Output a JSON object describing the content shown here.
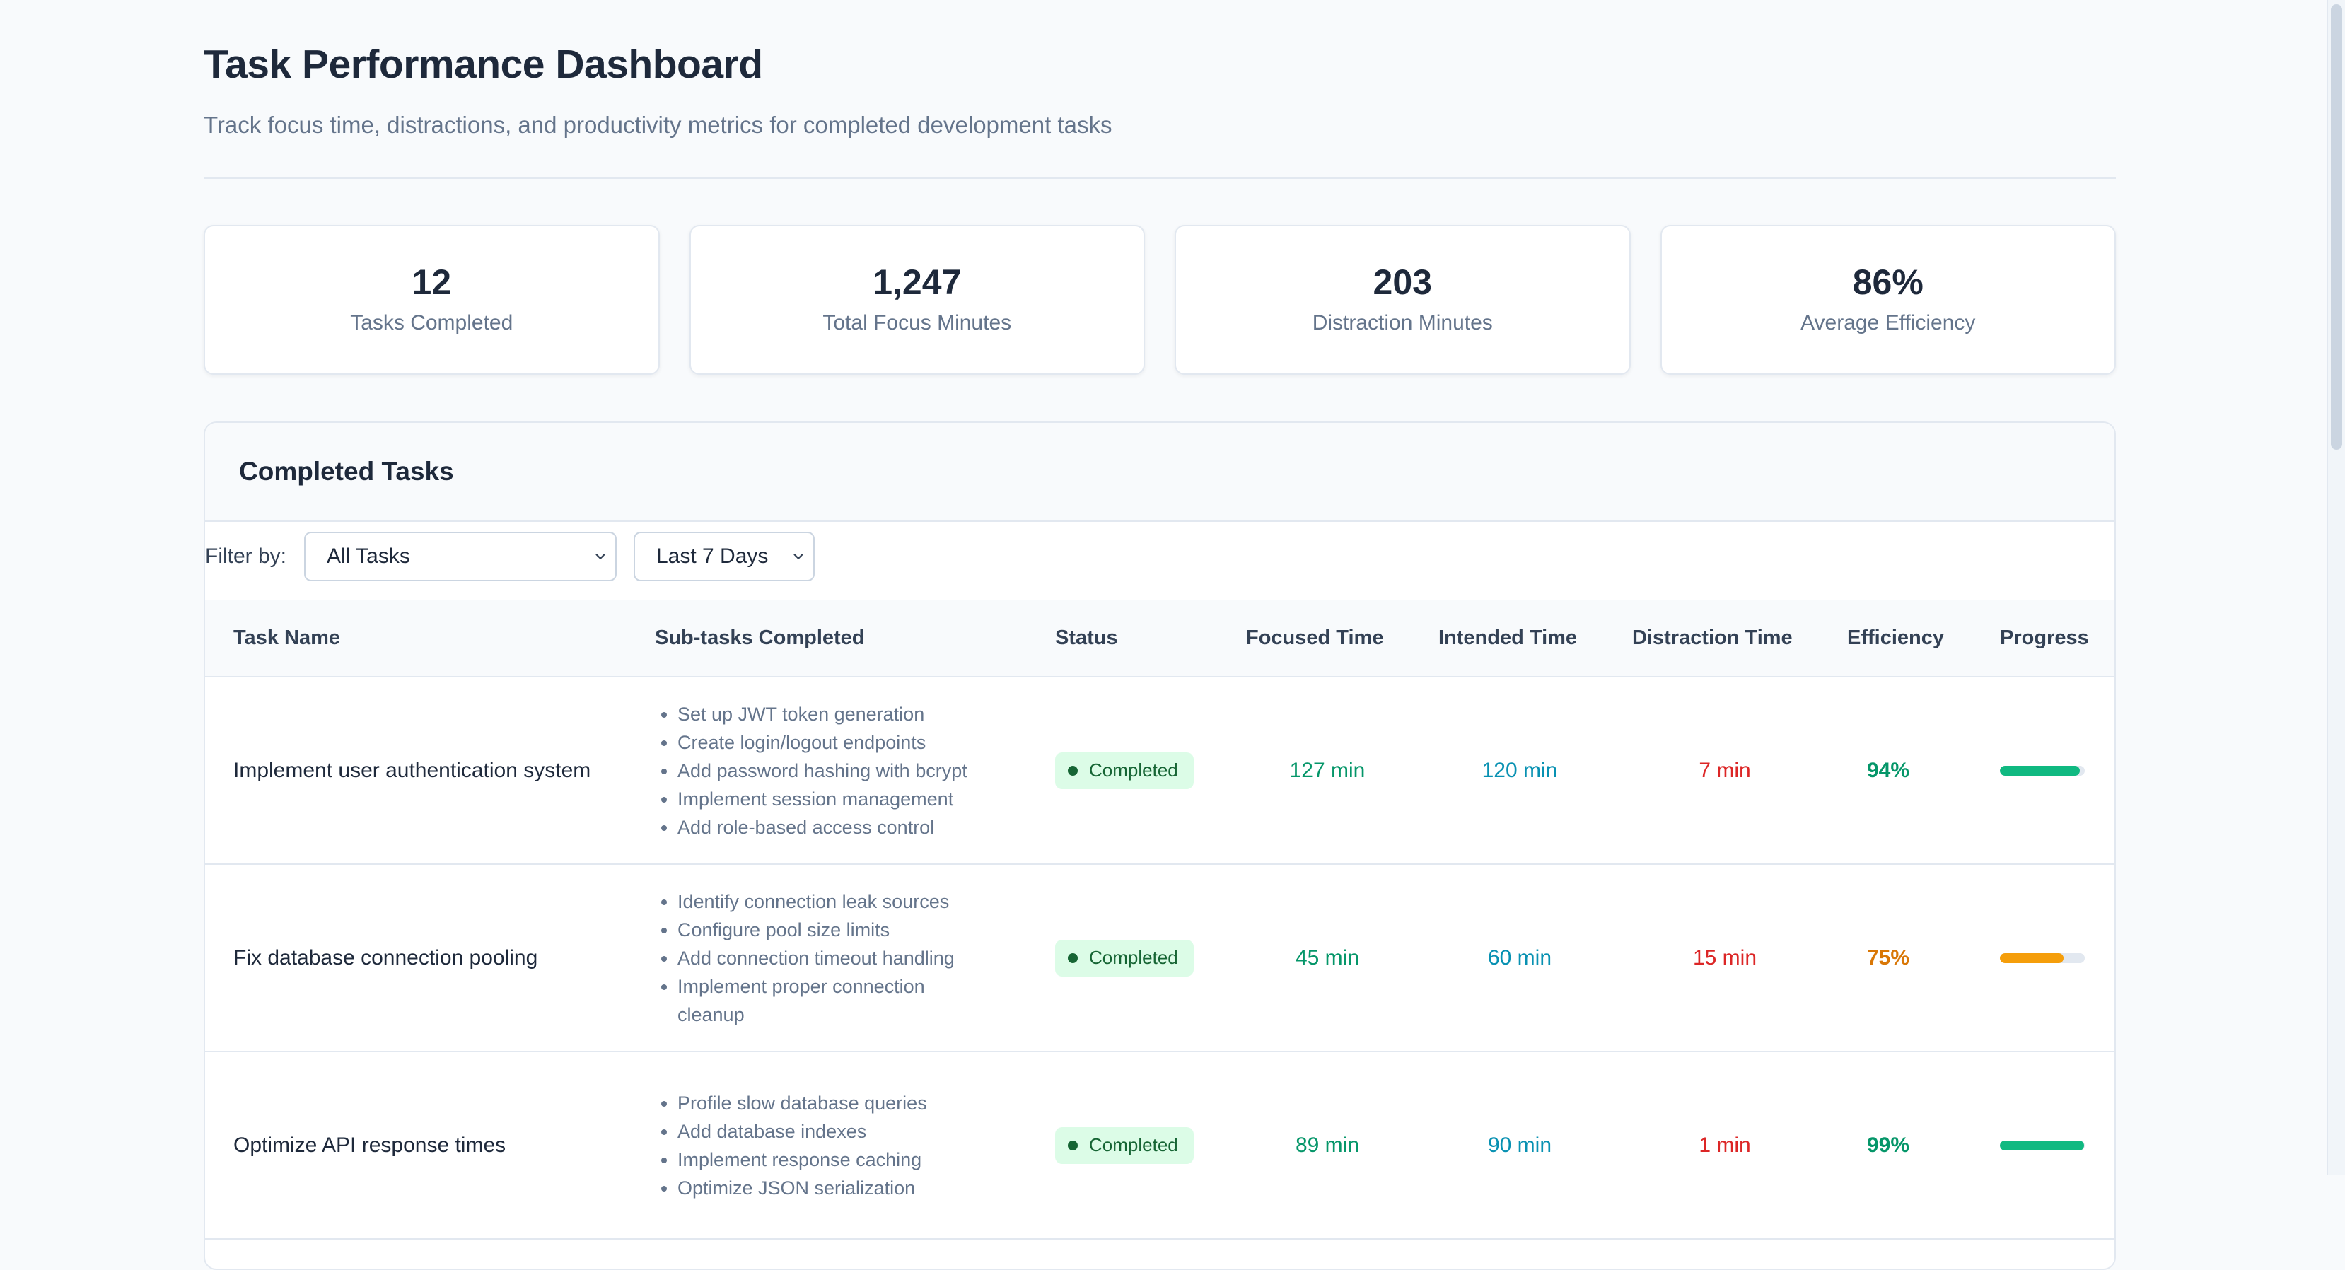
{
  "header": {
    "title": "Task Performance Dashboard",
    "subtitle": "Track focus time, distractions, and productivity metrics for completed development tasks"
  },
  "stats": [
    {
      "value": "12",
      "label": "Tasks Completed"
    },
    {
      "value": "1,247",
      "label": "Total Focus Minutes"
    },
    {
      "value": "203",
      "label": "Distraction Minutes"
    },
    {
      "value": "86%",
      "label": "Average Efficiency"
    }
  ],
  "panel": {
    "title": "Completed Tasks",
    "filter_label": "Filter by:",
    "task_filter": "All Tasks",
    "range_filter": "Last 7 Days"
  },
  "columns": {
    "task_name": "Task Name",
    "subtasks": "Sub-tasks Completed",
    "status": "Status",
    "focused": "Focused Time",
    "intended": "Intended Time",
    "distraction": "Distraction Time",
    "efficiency": "Efficiency",
    "progress": "Progress"
  },
  "tasks": [
    {
      "name": "Implement user authentication system",
      "subtasks": [
        "Set up JWT token generation",
        "Create login/logout endpoints",
        "Add password hashing with bcrypt",
        "Implement session management",
        "Add role-based access control"
      ],
      "status": "Completed",
      "focused": "127 min",
      "intended": "120 min",
      "distraction": "7 min",
      "efficiency": "94%",
      "progress": 0.94,
      "progress_color": "#10b981",
      "efficiency_color": "#059669"
    },
    {
      "name": "Fix database connection pooling",
      "subtasks": [
        "Identify connection leak sources",
        "Configure pool size limits",
        "Add connection timeout handling",
        "Implement proper connection cleanup"
      ],
      "status": "Completed",
      "focused": "45 min",
      "intended": "60 min",
      "distraction": "15 min",
      "efficiency": "75%",
      "progress": 0.75,
      "progress_color": "#f59e0b",
      "efficiency_color": "#d97706"
    },
    {
      "name": "Optimize API response times",
      "subtasks": [
        "Profile slow database queries",
        "Add database indexes",
        "Implement response caching",
        "Optimize JSON serialization"
      ],
      "status": "Completed",
      "focused": "89 min",
      "intended": "90 min",
      "distraction": "1 min",
      "efficiency": "99%",
      "progress": 0.99,
      "progress_color": "#10b981",
      "efficiency_color": "#059669"
    }
  ],
  "colors": {
    "focused": "#059669",
    "intended": "#0891b2",
    "distraction": "#dc2626"
  },
  "icons": {
    "select_arrow": "chevron-down-icon"
  }
}
